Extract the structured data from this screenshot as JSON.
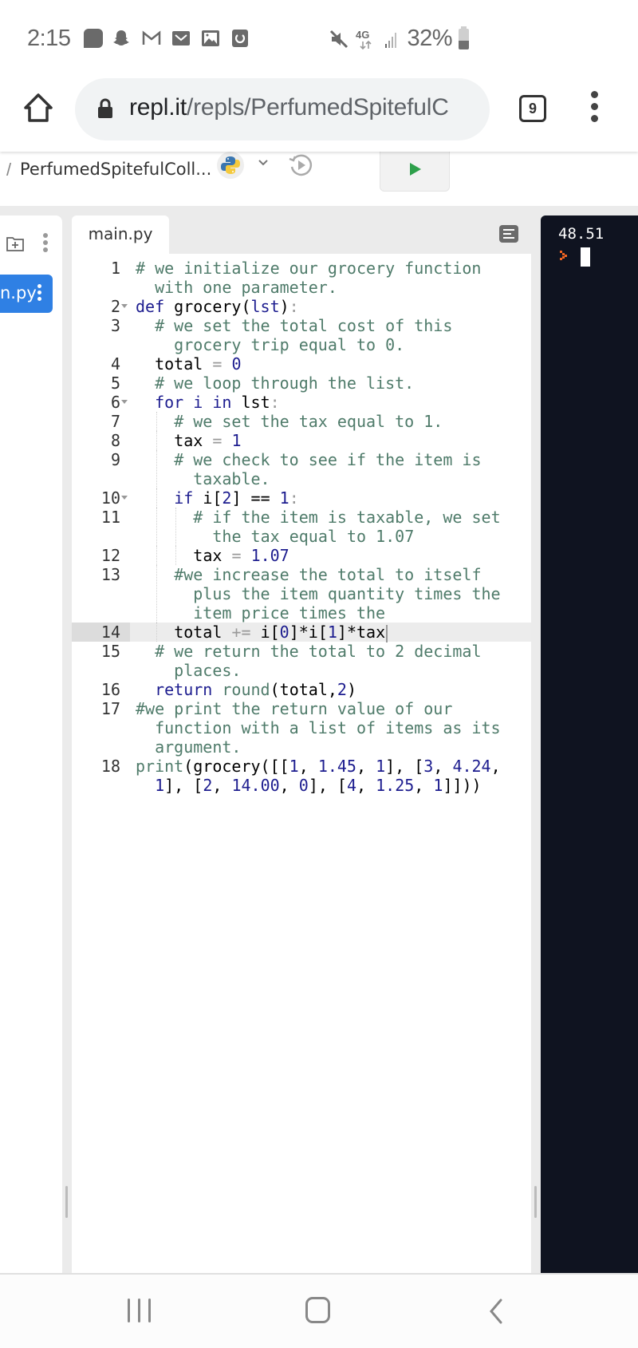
{
  "status_bar": {
    "time": "2:15",
    "notification_icons": [
      "message-icon",
      "snapchat-icon",
      "gmail-icon",
      "mail-icon",
      "gallery-icon",
      "app-icon"
    ],
    "system_icons": [
      "mute-icon",
      "4g-lte-icon",
      "signal-icon"
    ],
    "network": "4G",
    "battery_percent": "32%",
    "battery_level": 0.32
  },
  "browser": {
    "url_host": "repl.it",
    "url_path": "/repls/PerfumedSpitefulC",
    "tab_count": "9"
  },
  "repl_header": {
    "separator": "/",
    "repl_name": "PerfumedSpitefulColl...",
    "language": "python"
  },
  "file_panel": {
    "active_file": "n.py"
  },
  "editor": {
    "tab_label": "main.py",
    "active_line": 14,
    "lines": [
      {
        "num": "1",
        "fold": false,
        "rows": [
          [
            [
              "c",
              "# we initialize our grocery function"
            ]
          ],
          [
            [
              "c",
              "  with one parameter."
            ]
          ]
        ],
        "indent": 0
      },
      {
        "num": "2",
        "fold": true,
        "rows": [
          [
            [
              "k",
              "def"
            ],
            [
              "p",
              " grocery("
            ],
            [
              "n",
              "lst"
            ],
            [
              "p",
              ")"
            ],
            [
              "o",
              ":"
            ]
          ]
        ],
        "indent": 0
      },
      {
        "num": "3",
        "fold": false,
        "rows": [
          [
            [
              "c",
              "# we set the total cost of this"
            ]
          ],
          [
            [
              "c",
              "  grocery trip equal to 0."
            ]
          ]
        ],
        "indent": 1
      },
      {
        "num": "4",
        "fold": false,
        "rows": [
          [
            [
              "p",
              "total "
            ],
            [
              "o",
              "="
            ],
            [
              "p",
              " "
            ],
            [
              "n",
              "0"
            ]
          ]
        ],
        "indent": 1
      },
      {
        "num": "5",
        "fold": false,
        "rows": [
          [
            [
              "c",
              "# we loop through the list."
            ]
          ]
        ],
        "indent": 1
      },
      {
        "num": "6",
        "fold": true,
        "rows": [
          [
            [
              "k",
              "for"
            ],
            [
              "p",
              " "
            ],
            [
              "n",
              "i"
            ],
            [
              "p",
              " "
            ],
            [
              "k",
              "in"
            ],
            [
              "p",
              " lst"
            ],
            [
              "o",
              ":"
            ]
          ]
        ],
        "indent": 1
      },
      {
        "num": "7",
        "fold": false,
        "rows": [
          [
            [
              "c",
              "# we set the tax equal to 1."
            ]
          ]
        ],
        "indent": 2
      },
      {
        "num": "8",
        "fold": false,
        "rows": [
          [
            [
              "p",
              "tax "
            ],
            [
              "o",
              "="
            ],
            [
              "p",
              " "
            ],
            [
              "n",
              "1"
            ]
          ]
        ],
        "indent": 2
      },
      {
        "num": "9",
        "fold": false,
        "rows": [
          [
            [
              "c",
              "# we check to see if the item is"
            ]
          ],
          [
            [
              "c",
              "  taxable."
            ]
          ]
        ],
        "indent": 2
      },
      {
        "num": "10",
        "fold": true,
        "rows": [
          [
            [
              "k",
              "if"
            ],
            [
              "p",
              " i["
            ],
            [
              "n",
              "2"
            ],
            [
              "p",
              "] == "
            ],
            [
              "n",
              "1"
            ],
            [
              "o",
              ":"
            ]
          ]
        ],
        "indent": 2
      },
      {
        "num": "11",
        "fold": false,
        "rows": [
          [
            [
              "c",
              "# if the item is taxable, we set"
            ]
          ],
          [
            [
              "c",
              "  the tax equal to 1.07"
            ]
          ]
        ],
        "indent": 3
      },
      {
        "num": "12",
        "fold": false,
        "rows": [
          [
            [
              "p",
              "tax "
            ],
            [
              "o",
              "="
            ],
            [
              "p",
              " "
            ],
            [
              "n",
              "1.07"
            ]
          ]
        ],
        "indent": 3
      },
      {
        "num": "13",
        "fold": false,
        "rows": [
          [
            [
              "c",
              "#we increase the total to itself"
            ]
          ],
          [
            [
              "c",
              "  plus the item quantity times the"
            ]
          ],
          [
            [
              "c",
              "  item price times the"
            ]
          ]
        ],
        "indent": 2
      },
      {
        "num": "14",
        "fold": false,
        "rows": [
          [
            [
              "p",
              "total "
            ],
            [
              "o",
              "+="
            ],
            [
              "p",
              " i["
            ],
            [
              "n",
              "0"
            ],
            [
              "p",
              "]*i["
            ],
            [
              "n",
              "1"
            ],
            [
              "p",
              "]*tax"
            ]
          ]
        ],
        "indent": 2
      },
      {
        "num": "15",
        "fold": false,
        "rows": [
          [
            [
              "c",
              "# we return the total to 2 decimal"
            ]
          ],
          [
            [
              "c",
              "  places."
            ]
          ]
        ],
        "indent": 1
      },
      {
        "num": "16",
        "fold": false,
        "rows": [
          [
            [
              "k",
              "return"
            ],
            [
              "p",
              " "
            ],
            [
              "c",
              "round"
            ],
            [
              "p",
              "(total,"
            ],
            [
              "n",
              "2"
            ],
            [
              "p",
              ")"
            ]
          ]
        ],
        "indent": 1
      },
      {
        "num": "17",
        "fold": false,
        "rows": [
          [
            [
              "c",
              "#we print the return value of our"
            ]
          ],
          [
            [
              "c",
              "  function with a list of items as its"
            ]
          ],
          [
            [
              "c",
              "  argument."
            ]
          ]
        ],
        "indent": 0
      },
      {
        "num": "18",
        "fold": false,
        "rows": [
          [
            [
              "c",
              "print"
            ],
            [
              "p",
              "(grocery([["
            ],
            [
              "n",
              "1"
            ],
            [
              "p",
              ", "
            ],
            [
              "n",
              "1.45"
            ],
            [
              "p",
              ", "
            ],
            [
              "n",
              "1"
            ],
            [
              "p",
              "], ["
            ],
            [
              "n",
              "3"
            ],
            [
              "p",
              ", "
            ],
            [
              "n",
              "4.24"
            ],
            [
              "p",
              ","
            ]
          ],
          [
            [
              "p",
              "  "
            ],
            [
              "n",
              "1"
            ],
            [
              "p",
              "], ["
            ],
            [
              "n",
              "2"
            ],
            [
              "p",
              ", "
            ],
            [
              "n",
              "14.00"
            ],
            [
              "p",
              ", "
            ],
            [
              "n",
              "0"
            ],
            [
              "p",
              "], ["
            ],
            [
              "n",
              "4"
            ],
            [
              "p",
              ", "
            ],
            [
              "n",
              "1.25"
            ],
            [
              "p",
              ", "
            ],
            [
              "n",
              "1"
            ],
            [
              "p",
              "]]))"
            ]
          ]
        ],
        "indent": 0
      }
    ]
  },
  "console": {
    "output": "48.51",
    "prompt": "›"
  },
  "nav_bar": {
    "buttons": [
      "recents",
      "home",
      "back"
    ]
  },
  "colors": {
    "run_green": "#2ea04b",
    "file_active_blue": "#2f80e4",
    "console_bg": "#0f1320",
    "comment": "#4f7b6a",
    "keyword": "#1d1d8f",
    "prompt_orange": "#f26522"
  }
}
